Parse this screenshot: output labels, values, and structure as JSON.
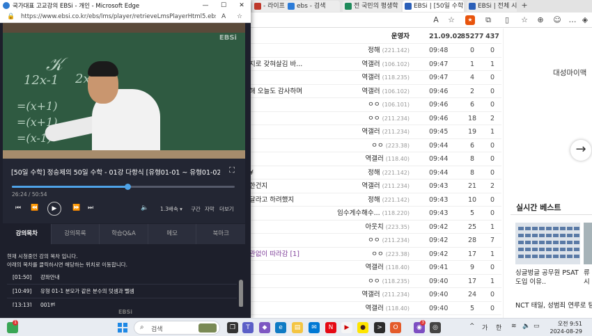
{
  "bg_browser": {
    "tabs": [
      {
        "label": "- 라이프",
        "color": "#c0392b"
      },
      {
        "label": "ebs - 검색",
        "color": "#2b7bd8"
      },
      {
        "label": "전 국민의 평생학",
        "color": "#1e8a5a"
      },
      {
        "label": "EBSi | [50일 수학]",
        "color": "#2b5fb8"
      },
      {
        "label": "EBSi | 전체 시리즈",
        "color": "#2b5fb8"
      }
    ],
    "new_tab": "+",
    "toolbar_icons": [
      "read-aloud-icon",
      "favorite-icon",
      "extensions-icon",
      "split-icon",
      "collections-icon",
      "profile-icon",
      "more-icon",
      "copilot-icon"
    ],
    "board": {
      "header": {
        "author": "운영자",
        "time": "21.09.02",
        "views": "85277",
        "recommends": "437"
      },
      "rows": [
        {
          "title": "",
          "author": "정해",
          "ip": "(221.142)",
          "time": "09:48",
          "views": "0",
          "rec": "0"
        },
        {
          "title": "지로 갖혀살김 바...",
          "author": "역갤러",
          "ip": "(106.102)",
          "time": "09:47",
          "views": "1",
          "rec": "1"
        },
        {
          "title": "",
          "author": "역갤러",
          "ip": "(118.235)",
          "time": "09:47",
          "views": "4",
          "rec": "0"
        },
        {
          "title": "해 오늘도 감사하며",
          "author": "역갤러",
          "ip": "(106.102)",
          "time": "09:46",
          "views": "2",
          "rec": "0"
        },
        {
          "title": "",
          "author": "ㅇㅇ",
          "ip": "(106.101)",
          "time": "09:46",
          "views": "6",
          "rec": "0"
        },
        {
          "title": "",
          "author": "ㅇㅇ",
          "ip": "(211.234)",
          "time": "09:46",
          "views": "18",
          "rec": "2"
        },
        {
          "title": "",
          "author": "역갤러",
          "ip": "(211.234)",
          "time": "09:45",
          "views": "19",
          "rec": "1"
        },
        {
          "title": "",
          "author": "ㅇㅇ",
          "ip": "(223.38)",
          "time": "09:44",
          "views": "6",
          "rec": "0"
        },
        {
          "title": "",
          "author": "역갤러",
          "ip": "(118.40)",
          "time": "09:44",
          "views": "8",
          "rec": "0"
        },
        {
          "title": "¥",
          "author": "정해",
          "ip": "(221.142)",
          "time": "09:44",
          "views": "8",
          "rec": "0"
        },
        {
          "title": "한건지",
          "author": "역갤러",
          "ip": "(211.234)",
          "time": "09:43",
          "views": "21",
          "rec": "2"
        },
        {
          "title": "달라고 하려했지",
          "author": "정해",
          "ip": "(221.142)",
          "time": "09:43",
          "views": "10",
          "rec": "0"
        },
        {
          "title": "",
          "author": "임수게수해수...",
          "ip": "(118.220)",
          "time": "09:43",
          "views": "5",
          "rec": "0"
        },
        {
          "title": "",
          "author": "아웃치",
          "ip": "(223.35)",
          "time": "09:42",
          "views": "25",
          "rec": "1"
        },
        {
          "title": "",
          "author": "ㅇㅇ",
          "ip": "(211.234)",
          "time": "09:42",
          "views": "28",
          "rec": "7"
        },
        {
          "title": "관없이 따라감 [1]",
          "author": "ㅇㅇ",
          "ip": "(223.38)",
          "time": "09:42",
          "views": "17",
          "rec": "1",
          "purple": true
        },
        {
          "title": "",
          "author": "역갤러",
          "ip": "(118.40)",
          "time": "09:41",
          "views": "9",
          "rec": "0"
        },
        {
          "title": "",
          "author": "ㅇㅇ",
          "ip": "(118.235)",
          "time": "09:40",
          "views": "17",
          "rec": "1"
        },
        {
          "title": "",
          "author": "역갤러",
          "ip": "(211.234)",
          "time": "09:40",
          "views": "24",
          "rec": "0"
        },
        {
          "title": "",
          "author": "역갤러",
          "ip": "(118.40)",
          "time": "09:40",
          "views": "5",
          "rec": "0"
        }
      ]
    },
    "right": {
      "fav_label": "대성마이맥",
      "next_arrow": "→",
      "best_title": "실시간 베스트",
      "best_caption": "싱글벙글 공무원 PSAT 도입 이유..",
      "best_caption2": "류시",
      "best_news": "NCT 태일, 성범죄 연루로 팀 탈퇴"
    }
  },
  "popup": {
    "title": "국가대표 고교강의 EBSi - 개인 - Microsoft Edge",
    "url": "https://www.ebsi.co.kr/ebs/lms/player/retrieveLmsPlayerHtml5.ebs?sbjtapplyld...",
    "watermark": "EBSi",
    "lecture_title": "[50일 수학] 정승제의 50일 수학 - 01강 다항식 [유형01-01 ~ 유형01-02]",
    "time": "26:24 / 50:54",
    "progress": 0.52,
    "speed": "1.3배속 ▾",
    "options": [
      "구간",
      "자막",
      "더보기"
    ],
    "tabs": [
      "강의목차",
      "강의목록",
      "학습Q&A",
      "메모",
      "북마크"
    ],
    "active_tab": 0,
    "note_line1": "현재 시청중인 강의 목차 입니다.",
    "note_line2": "아래의 목차를 클릭하시면 해당하는 위치로 이동합니다.",
    "chapters": [
      {
        "time": "[01:50]",
        "label": "강좌안내"
      },
      {
        "time": "[10:49]",
        "label": "유형 01-1 분모가 같은 분수의 덧셈과 뺄셈"
      },
      {
        "time": "[13:13]",
        "label": "001번"
      }
    ],
    "footer": "EBSi"
  },
  "taskbar": {
    "search_placeholder": "검색",
    "weather_badge": "1",
    "ime": "가",
    "lang": "한",
    "time": "오전 9:51",
    "date": "2024-08-29",
    "notification_count": "3"
  }
}
